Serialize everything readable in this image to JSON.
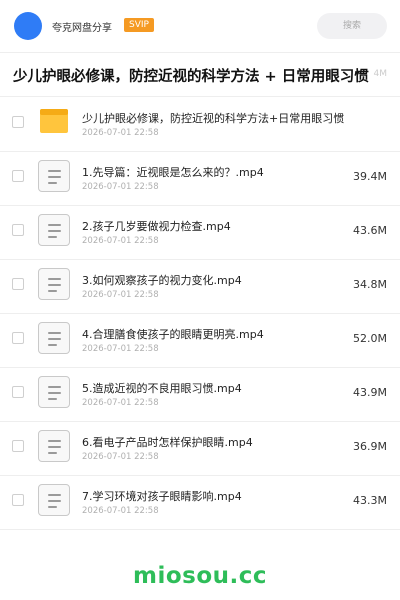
{
  "header": {
    "user_name": "夸克网盘分享",
    "badge": "SVIP",
    "search_placeholder": "搜索"
  },
  "title": {
    "text": "少儿护眼必修课，防控近视的科学方法 + 日常用眼习惯",
    "size_partial": "4M"
  },
  "folder": {
    "name": "少儿护眼必修课，防控近视的科学方法+日常用眼习惯",
    "date": "2026-07-01 22:58"
  },
  "files": [
    {
      "name": "1.先导篇：近视眼是怎么来的？.mp4",
      "date": "2026-07-01 22:58",
      "size": "39.4M"
    },
    {
      "name": "2.孩子几岁要做视力检查.mp4",
      "date": "2026-07-01 22:58",
      "size": "43.6M"
    },
    {
      "name": "3.如何观察孩子的视力变化.mp4",
      "date": "2026-07-01 22:58",
      "size": "34.8M"
    },
    {
      "name": "4.合理膳食使孩子的眼睛更明亮.mp4",
      "date": "2026-07-01 22:58",
      "size": "52.0M"
    },
    {
      "name": "5.造成近视的不良用眼习惯.mp4",
      "date": "2026-07-01 22:58",
      "size": "43.9M"
    },
    {
      "name": "6.看电子产品时怎样保护眼睛.mp4",
      "date": "2026-07-01 22:58",
      "size": "36.9M"
    },
    {
      "name": "7.学习环境对孩子眼睛影响.mp4",
      "date": "2026-07-01 22:58",
      "size": "43.3M"
    }
  ],
  "watermark": "miosou.cc"
}
